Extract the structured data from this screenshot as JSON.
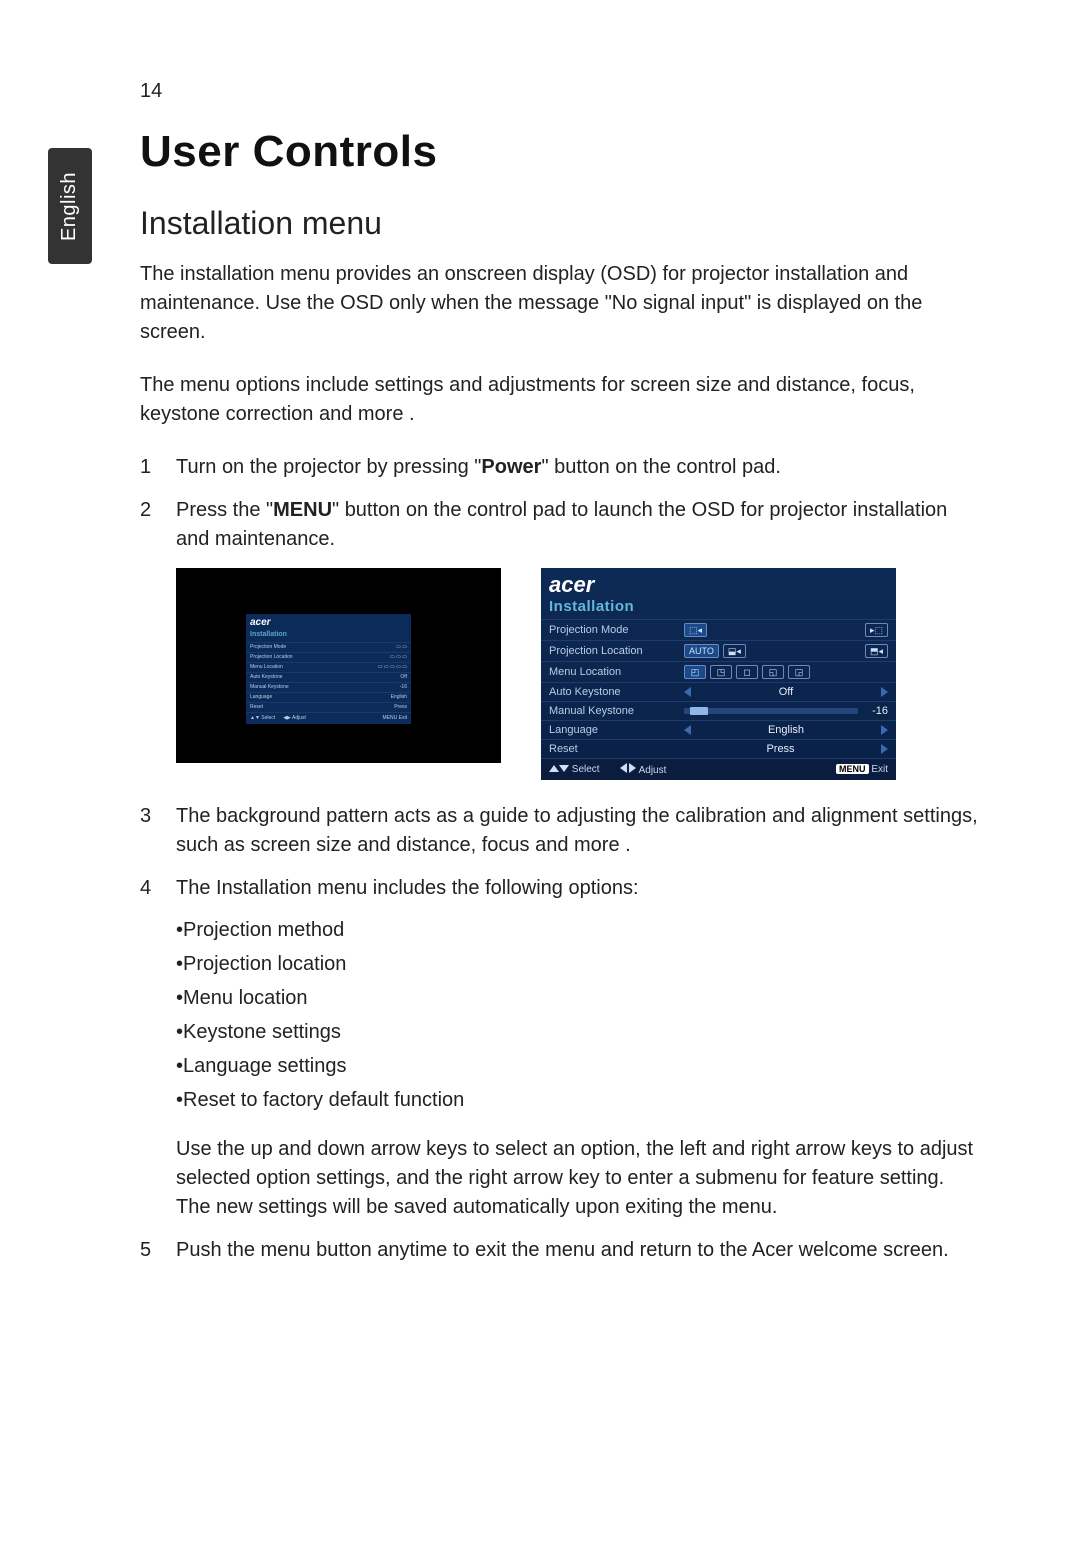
{
  "page_number": "14",
  "language_tab": "English",
  "h1": "User Controls",
  "h2": "Installation menu",
  "intro": "The installation menu provides an onscreen display (OSD) for projector installation and maintenance. Use the OSD only when the message \"No signal input\" is displayed on the screen.",
  "intro2": "The menu options include settings and adjustments for screen size and distance, focus, keystone correction and more .",
  "steps": {
    "s1_pre": "Turn on the projector by pressing \"",
    "s1_bold": "Power",
    "s1_post": "\" button on the control pad.",
    "s2_pre": "Press the \"",
    "s2_bold": "MENU",
    "s2_post": "\" button on the control pad to launch the OSD for projector installation and maintenance.",
    "s3": "The background pattern acts as a guide to adjusting the calibration and alignment settings, such as screen size and distance, focus and more .",
    "s4_lead": "The Installation menu includes the following options:",
    "s4_items": [
      "•Projection method",
      "•Projection location",
      "•Menu location",
      "•Keystone settings",
      "•Language settings",
      "•Reset to factory default function"
    ],
    "s4_tail": "Use the up and down arrow keys to select an option, the left and right arrow keys to adjust selected option settings, and the right arrow key to enter a submenu for feature setting. The new settings will be saved automatically upon exiting the menu.",
    "s5": "Push the menu button anytime to exit the menu and return to the Acer welcome screen."
  },
  "osd": {
    "brand": "acer",
    "title": "Installation",
    "rows": {
      "projection_mode": "Projection Mode",
      "projection_location": "Projection Location",
      "menu_location": "Menu Location",
      "auto_keystone": "Auto Keystone",
      "auto_keystone_value": "Off",
      "manual_keystone": "Manual Keystone",
      "manual_keystone_value": "-16",
      "language": "Language",
      "language_value": "English",
      "reset": "Reset",
      "reset_value": "Press"
    },
    "footer": {
      "select": "Select",
      "adjust": "Adjust",
      "menu": "MENU",
      "exit": "Exit"
    },
    "proj_loc_auto": "AUTO"
  }
}
